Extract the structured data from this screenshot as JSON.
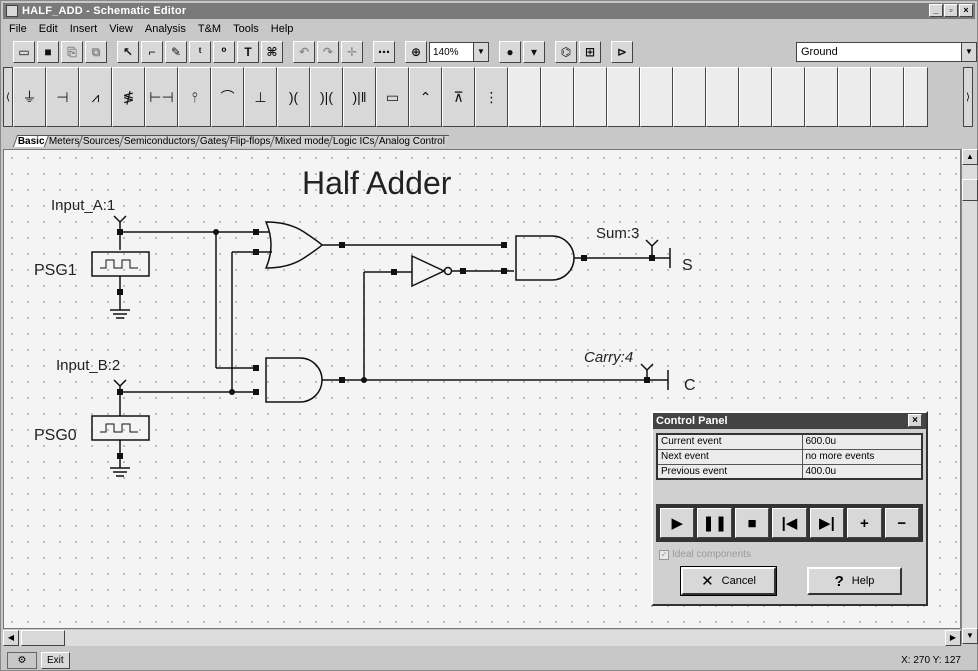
{
  "window": {
    "title": "HALF_ADD - Schematic Editor"
  },
  "menu": [
    "File",
    "Edit",
    "Insert",
    "View",
    "Analysis",
    "T&M",
    "Tools",
    "Help"
  ],
  "toolbar": {
    "zoom": "140%",
    "component_select": "Ground"
  },
  "tabs": [
    "Basic",
    "Meters",
    "Sources",
    "Semiconductors",
    "Gates",
    "Flip-flops",
    "Mixed mode",
    "Logic ICs",
    "Analog Control"
  ],
  "schematic": {
    "title": "Half Adder",
    "labels": {
      "input_a": "Input_A:1",
      "input_b": "Input_B:2",
      "psg1": "PSG1",
      "psg0": "PSG0",
      "sum": "Sum:3",
      "carry": "Carry:4",
      "s": "S",
      "c": "C"
    }
  },
  "control_panel": {
    "title": "Control Panel",
    "rows": [
      {
        "label": "Current event",
        "value": "600.0u"
      },
      {
        "label": "Next event",
        "value": "no more events"
      },
      {
        "label": "Previous event",
        "value": "400.0u"
      }
    ],
    "ideal_components": "Ideal components",
    "cancel": "Cancel",
    "help": "Help"
  },
  "status": {
    "exit": "Exit",
    "coords": "X: 270  Y: 127"
  },
  "colors": {
    "titlebar": "#7a7a7a",
    "window_bg": "#c8c8c8",
    "canvas_bg": "#f4f4f4"
  }
}
